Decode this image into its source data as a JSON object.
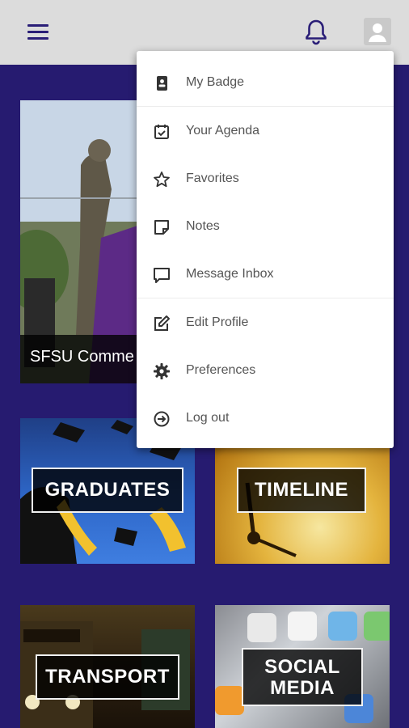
{
  "colors": {
    "brand": "#261b70",
    "appbar": "#dcdcdc",
    "menu_text": "#555555",
    "icon": "#2a1e77"
  },
  "header": {
    "menu_icon": "hamburger-menu-icon",
    "notifications_icon": "bell-icon",
    "profile_icon": "user-avatar-icon"
  },
  "menu": {
    "items": [
      {
        "label": "My Badge",
        "icon": "badge-icon"
      },
      {
        "label": "Your Agenda",
        "icon": "calendar-check-icon"
      },
      {
        "label": "Favorites",
        "icon": "star-icon"
      },
      {
        "label": "Notes",
        "icon": "note-icon"
      },
      {
        "label": "Message Inbox",
        "icon": "message-icon"
      },
      {
        "label": "Edit Profile",
        "icon": "edit-icon"
      },
      {
        "label": "Preferences",
        "icon": "gear-icon"
      },
      {
        "label": "Log out",
        "icon": "logout-icon"
      }
    ]
  },
  "tiles": {
    "hero_caption": "SFSU Comme",
    "graduates": "GRADUATES",
    "timeline": "TIMELINE",
    "transport": "TRANSPORT",
    "social_line1": "SOCIAL",
    "social_line2": "MEDIA"
  }
}
